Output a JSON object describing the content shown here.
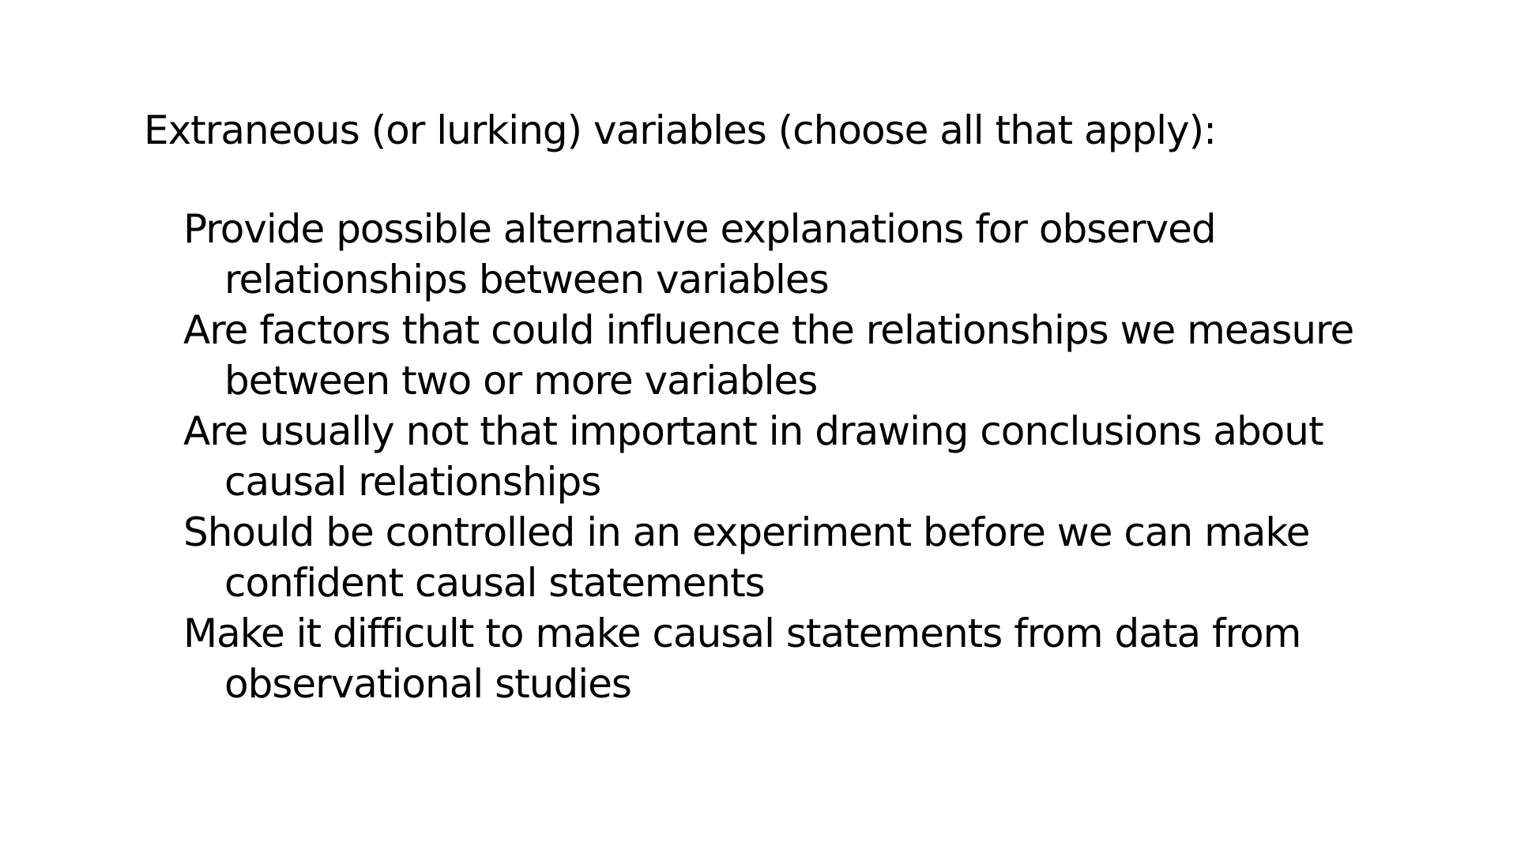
{
  "slide": {
    "question": "Extraneous (or lurking) variables (choose all that apply):",
    "options": [
      {
        "text": "Provide possible alternative explanations for observed relationships between variables"
      },
      {
        "text": "Are factors that could influence the relationships we measure between two or more variables"
      },
      {
        "text": "Are usually not that important in drawing conclusions about causal relationships"
      },
      {
        "text": "Should be controlled in an experiment before we can make confident causal statements"
      },
      {
        "text": "Make it difficult to make causal statements from data from observational studies"
      }
    ]
  }
}
